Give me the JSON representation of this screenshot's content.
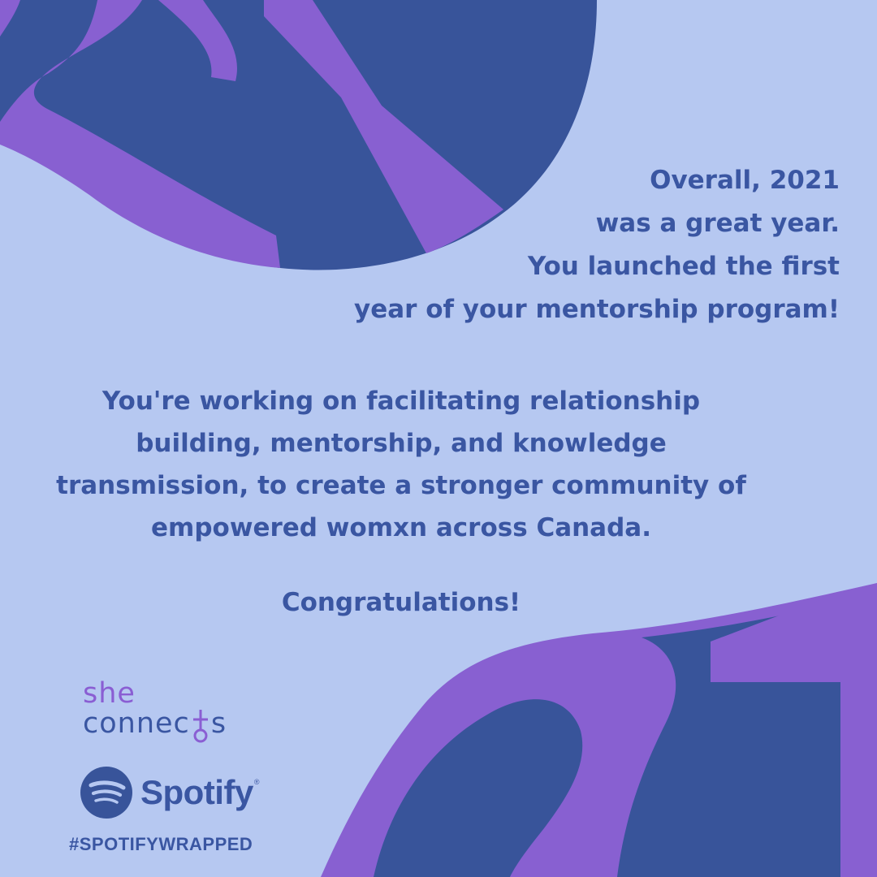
{
  "colors": {
    "background": "#b6c8f1",
    "navy": "#38549a",
    "purple": "#8860d1",
    "text": "#3a56a2"
  },
  "intro": {
    "lines": [
      "Overall, 2021",
      "was a great year.",
      "You launched the first",
      "year of your mentorship program!"
    ]
  },
  "body": {
    "lines": [
      "You're working on facilitating relationship",
      "building, mentorship, and knowledge",
      "transmission, to create a stronger community of",
      "empowered womxn across Canada."
    ],
    "congrats": "Congratulations!"
  },
  "logo": {
    "line1": "she",
    "line2_prefix": "connec",
    "line2_suffix": "s"
  },
  "spotify": {
    "wordmark": "Spotify",
    "registered": "®"
  },
  "hashtag": "#SPOTIFYWRAPPED"
}
